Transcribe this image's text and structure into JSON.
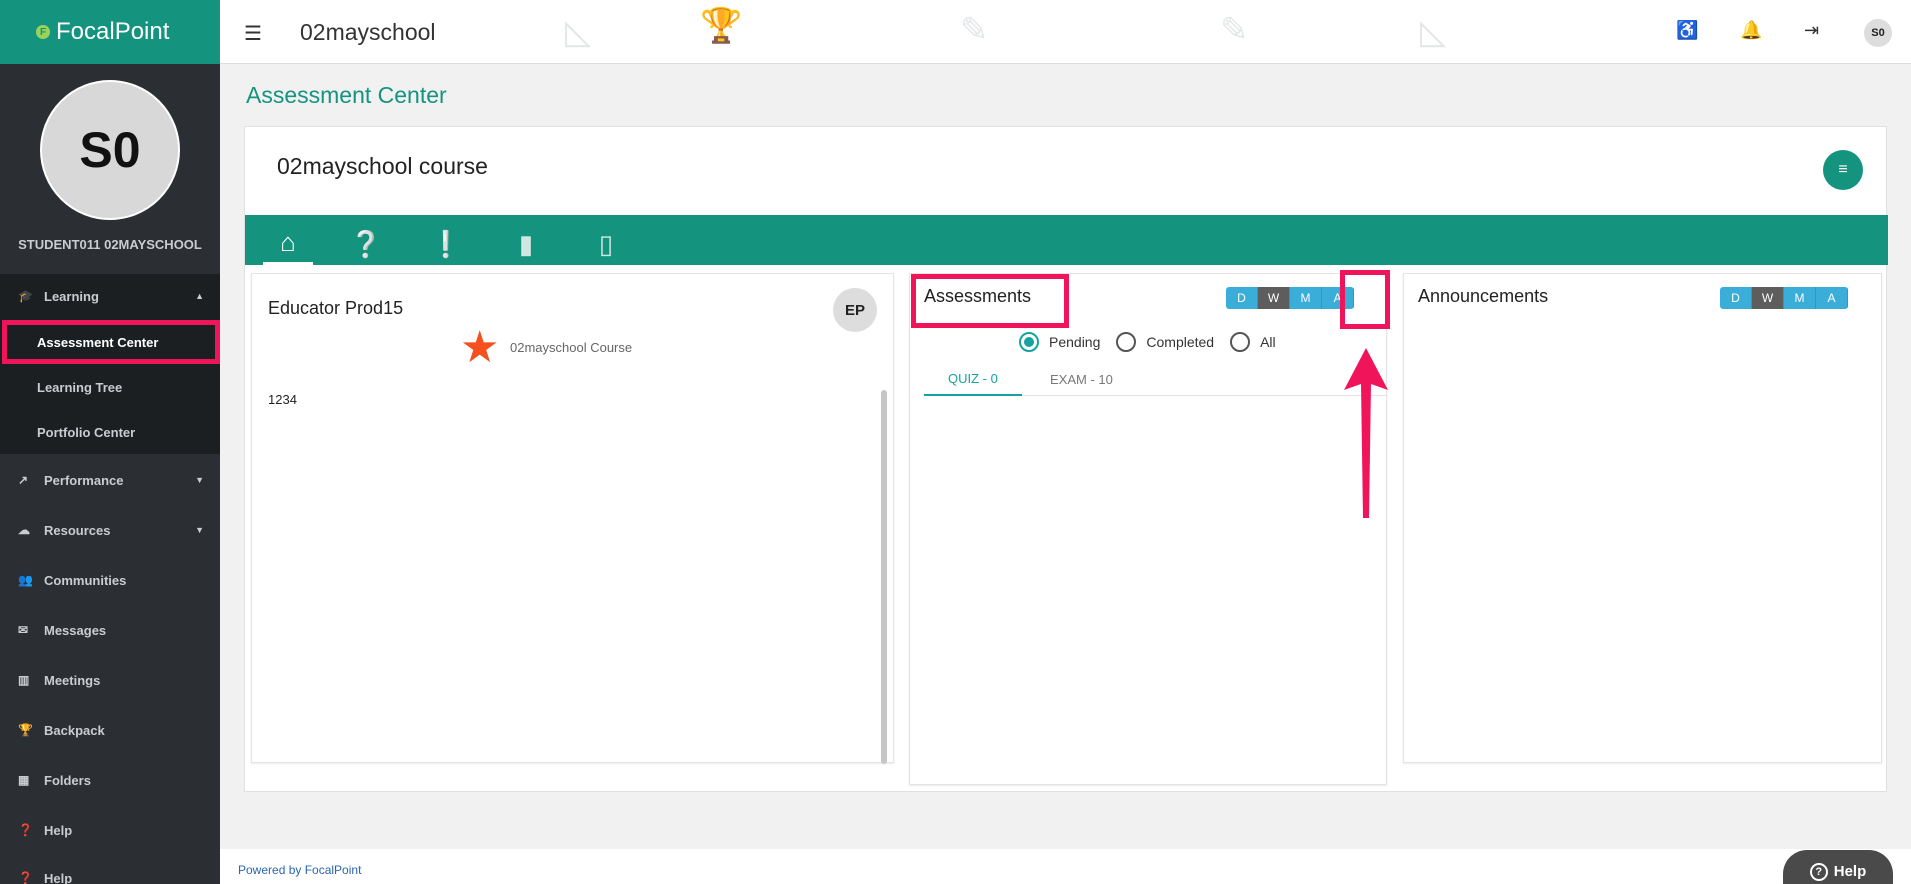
{
  "brand": {
    "name": "FocalPoint",
    "mark": "F"
  },
  "header": {
    "school": "02mayschool",
    "avatar_initials": "S0"
  },
  "user": {
    "initials": "S0",
    "name": "STUDENT011 02MAYSCHOOL"
  },
  "sidebar": {
    "learning": "Learning",
    "learning_sub": [
      "Assessment Center",
      "Learning Tree",
      "Portfolio Center"
    ],
    "items": [
      "Performance",
      "Resources",
      "Communities",
      "Messages",
      "Meetings",
      "Backpack",
      "Folders",
      "Help",
      "Help"
    ]
  },
  "page": {
    "title": "Assessment Center"
  },
  "course": {
    "title": "02mayschool course"
  },
  "educator": {
    "name": "Educator Prod15",
    "initials": "EP",
    "course": "02mayschool Course",
    "note": "1234"
  },
  "assessments": {
    "title": "Assessments",
    "filters": [
      "D",
      "W",
      "M",
      "A"
    ],
    "radios": [
      "Pending",
      "Completed",
      "All"
    ],
    "tabs": [
      "QUIZ - 0",
      "EXAM - 10"
    ]
  },
  "announcements": {
    "title": "Announcements",
    "filters": [
      "D",
      "W",
      "M",
      "A"
    ]
  },
  "footer": {
    "powered": "Powered by FocalPoint",
    "help": "Help"
  },
  "colors": {
    "brand": "#14947f",
    "highlight": "#f0145a",
    "filter": "#3aaed8"
  }
}
